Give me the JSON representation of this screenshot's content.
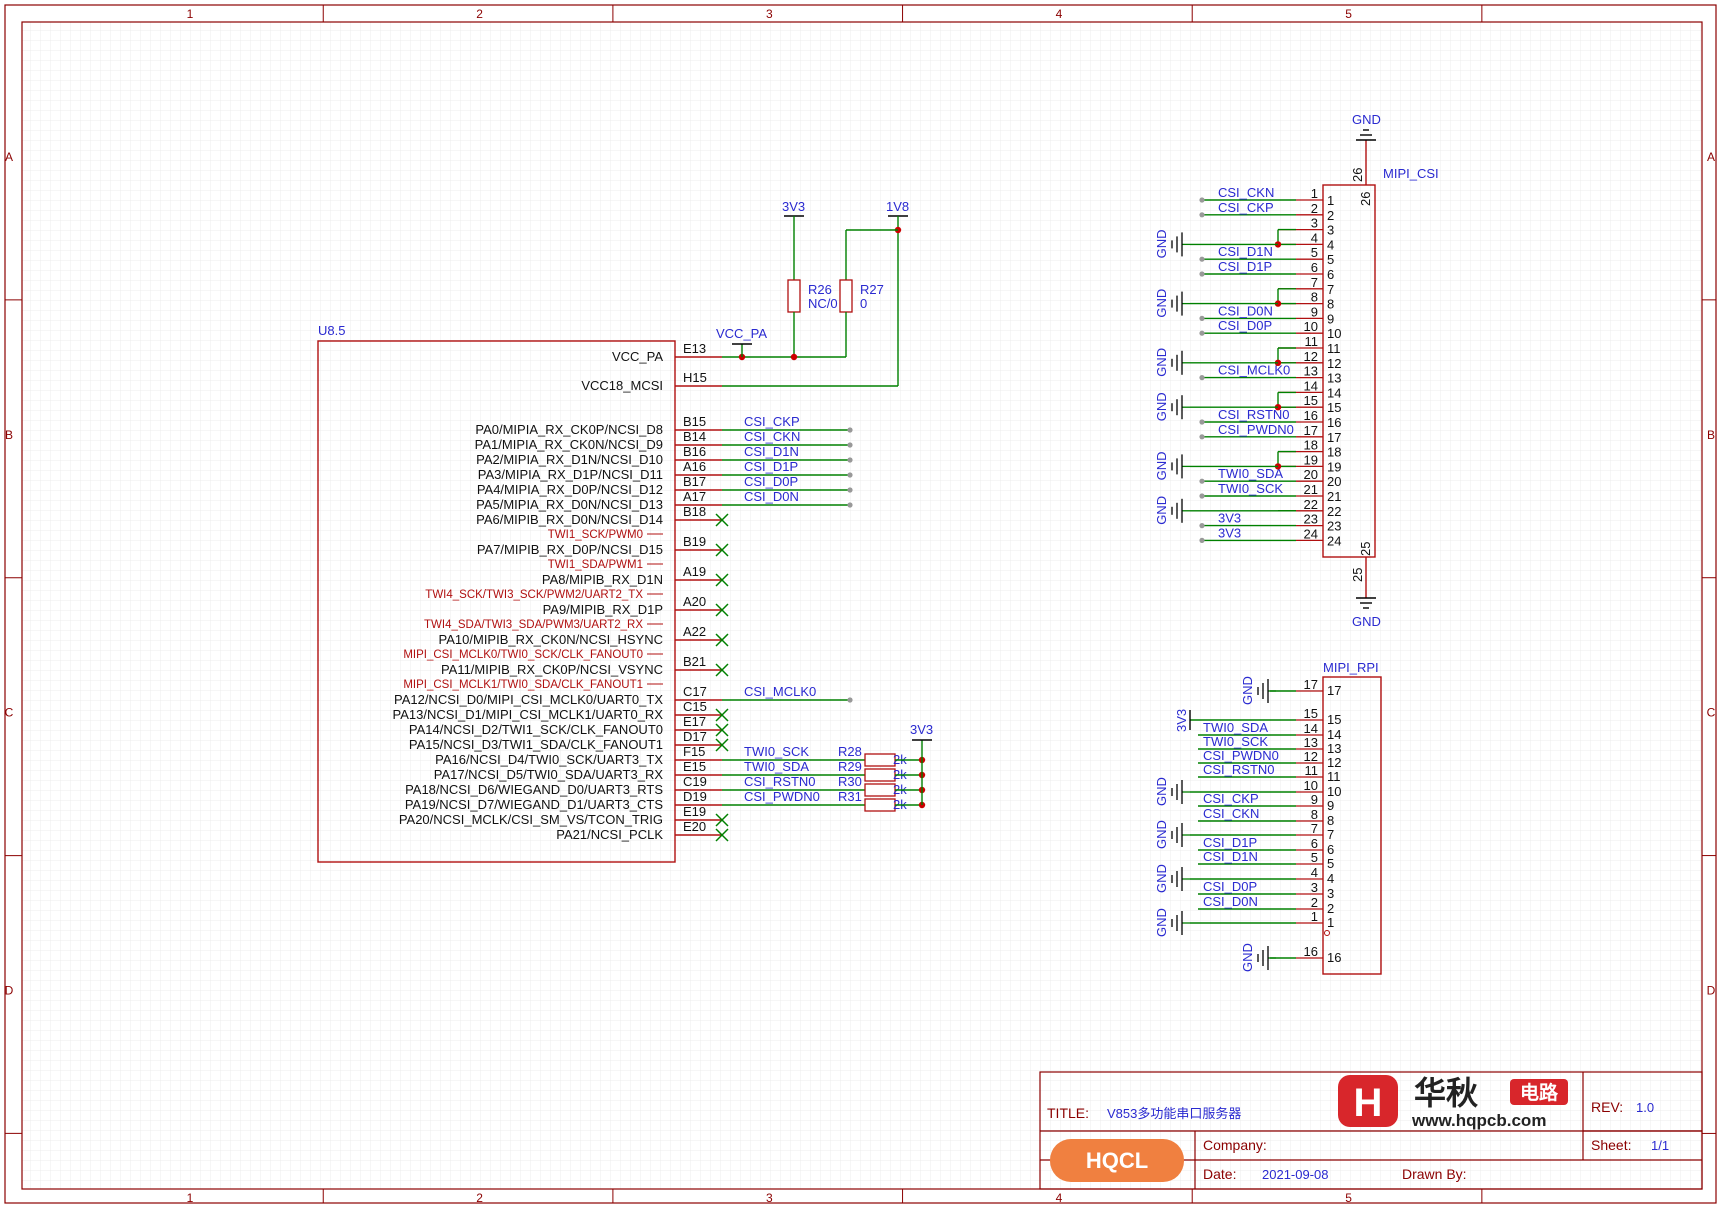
{
  "frame": {
    "columns": [
      "1",
      "2",
      "3",
      "4",
      "5"
    ],
    "rows": [
      "A",
      "B",
      "C",
      "D"
    ]
  },
  "u8": {
    "ref": "U8.5",
    "pins": [
      {
        "name": "VCC_PA",
        "num": "E13"
      },
      {
        "name": "VCC18_MCSI",
        "num": "H15"
      },
      {
        "name": "PA0/MIPIA_RX_CK0P/NCSI_D8",
        "num": "B15",
        "net": "CSI_CKP"
      },
      {
        "name": "PA1/MIPIA_RX_CK0N/NCSI_D9",
        "num": "B14",
        "net": "CSI_CKN"
      },
      {
        "name": "PA2/MIPIA_RX_D1N/NCSI_D10",
        "num": "B16",
        "net": "CSI_D1N"
      },
      {
        "name": "PA3/MIPIA_RX_D1P/NCSI_D11",
        "num": "A16",
        "net": "CSI_D1P"
      },
      {
        "name": "PA4/MIPIA_RX_D0P/NCSI_D12",
        "num": "B17",
        "net": "CSI_D0P"
      },
      {
        "name": "PA5/MIPIA_RX_D0N/NCSI_D13",
        "num": "A17",
        "net": "CSI_D0N"
      },
      {
        "name": "PA6/MIPIB_RX_D0N/NCSI_D14",
        "num": "B18",
        "alt": "TWI1_SCK/PWM0"
      },
      {
        "name": "PA7/MIPIB_RX_D0P/NCSI_D15",
        "num": "B19",
        "alt": "TWI1_SDA/PWM1"
      },
      {
        "name": "PA8/MIPIB_RX_D1N",
        "num": "A19",
        "alt": "TWI4_SCK/TWI3_SCK/PWM2/UART2_TX"
      },
      {
        "name": "PA9/MIPIB_RX_D1P",
        "num": "A20",
        "alt": "TWI4_SDA/TWI3_SDA/PWM3/UART2_RX"
      },
      {
        "name": "PA10/MIPIB_RX_CK0N/NCSI_HSYNC",
        "num": "A22",
        "alt": "MIPI_CSI_MCLK0/TWI0_SCK/CLK_FANOUT0"
      },
      {
        "name": "PA11/MIPIB_RX_CK0P/NCSI_VSYNC",
        "num": "B21",
        "alt": "MIPI_CSI_MCLK1/TWI0_SDA/CLK_FANOUT1"
      },
      {
        "name": "PA12/NCSI_D0/MIPI_CSI_MCLK0/UART0_TX",
        "num": "C17",
        "net": "CSI_MCLK0"
      },
      {
        "name": "PA13/NCSI_D1/MIPI_CSI_MCLK1/UART0_RX",
        "num": "C15"
      },
      {
        "name": "PA14/NCSI_D2/TWI1_SCK/CLK_FANOUT0",
        "num": "E17"
      },
      {
        "name": "PA15/NCSI_D3/TWI1_SDA/CLK_FANOUT1",
        "num": "D17"
      },
      {
        "name": "PA16/NCSI_D4/TWI0_SCK/UART3_TX",
        "num": "F15",
        "net": "TWI0_SCK",
        "res": "R28",
        "val": "2k"
      },
      {
        "name": "PA17/NCSI_D5/TWI0_SDA/UART3_RX",
        "num": "E15",
        "net": "TWI0_SDA",
        "res": "R29",
        "val": "2k"
      },
      {
        "name": "PA18/NCSI_D6/WIEGAND_D0/UART3_RTS",
        "num": "C19",
        "net": "CSI_RSTN0",
        "res": "R30",
        "val": "2k"
      },
      {
        "name": "PA19/NCSI_D7/WIEGAND_D1/UART3_CTS",
        "num": "D19",
        "net": "CSI_PWDN0",
        "res": "R31",
        "val": "2k"
      },
      {
        "name": "PA20/NCSI_MCLK/CSI_SM_VS/TCON_TRIG",
        "num": "E19"
      },
      {
        "name": "PA21/NCSI_PCLK",
        "num": "E20"
      }
    ]
  },
  "power": {
    "v33": "3V3",
    "v18": "1V8",
    "vcc_pa": "VCC_PA",
    "gnd": "GND",
    "r26": {
      "ref": "R26",
      "val": "NC/0"
    },
    "r27": {
      "ref": "R27",
      "val": "0"
    }
  },
  "mipi_csi": {
    "ref": "MIPI_CSI",
    "top_pin": "26",
    "bottom_pin": "25",
    "pins": [
      {
        "n": "1",
        "net": "CSI_CKN",
        "kind": "net"
      },
      {
        "n": "2",
        "net": "CSI_CKP",
        "kind": "net"
      },
      {
        "n": "3",
        "kind": "gnd"
      },
      {
        "n": "4",
        "kind": "gnd"
      },
      {
        "n": "5",
        "net": "CSI_D1N",
        "kind": "net"
      },
      {
        "n": "6",
        "net": "CSI_D1P",
        "kind": "net"
      },
      {
        "n": "7",
        "kind": "gnd"
      },
      {
        "n": "8",
        "kind": "gnd"
      },
      {
        "n": "9",
        "net": "CSI_D0N",
        "kind": "net"
      },
      {
        "n": "10",
        "net": "CSI_D0P",
        "kind": "net"
      },
      {
        "n": "11",
        "kind": "gnd"
      },
      {
        "n": "12",
        "kind": "gnd"
      },
      {
        "n": "13",
        "net": "CSI_MCLK0",
        "kind": "net"
      },
      {
        "n": "14",
        "kind": "gnd"
      },
      {
        "n": "15",
        "kind": "gnd"
      },
      {
        "n": "16",
        "net": "CSI_RSTN0",
        "kind": "net"
      },
      {
        "n": "17",
        "net": "CSI_PWDN0",
        "kind": "net"
      },
      {
        "n": "18",
        "kind": "gnd"
      },
      {
        "n": "19",
        "kind": "gnd"
      },
      {
        "n": "20",
        "net": "TWI0_SDA",
        "kind": "net"
      },
      {
        "n": "21",
        "net": "TWI0_SCK",
        "kind": "net"
      },
      {
        "n": "22",
        "kind": "gnd"
      },
      {
        "n": "23",
        "net": "3V3",
        "kind": "net"
      },
      {
        "n": "24",
        "net": "3V3",
        "kind": "net"
      }
    ]
  },
  "mipi_rpi": {
    "ref": "MIPI_RPI",
    "rows": [
      {
        "left": "17",
        "right": "17",
        "kind": "gnd"
      },
      {
        "left": "15",
        "right": "15",
        "kind": "pwr",
        "label": "3V3"
      },
      {
        "left": "14",
        "right": "14",
        "net": "TWI0_SDA"
      },
      {
        "left": "13",
        "right": "13",
        "net": "TWI0_SCK"
      },
      {
        "left": "12",
        "right": "12",
        "net": "CSI_PWDN0"
      },
      {
        "left": "11",
        "right": "11",
        "net": "CSI_RSTN0"
      },
      {
        "left": "10",
        "right": "10",
        "kind": "gnd"
      },
      {
        "left": "9",
        "right": "9",
        "net": "CSI_CKP"
      },
      {
        "left": "8",
        "right": "8",
        "net": "CSI_CKN"
      },
      {
        "left": "7",
        "right": "7",
        "kind": "gnd"
      },
      {
        "left": "6",
        "right": "6",
        "net": "CSI_D1P"
      },
      {
        "left": "5",
        "right": "5",
        "net": "CSI_D1N"
      },
      {
        "left": "4",
        "right": "4",
        "kind": "gnd"
      },
      {
        "left": "3",
        "right": "3",
        "net": "CSI_D0P"
      },
      {
        "left": "2",
        "right": "2",
        "net": "CSI_D0N"
      },
      {
        "left": "1",
        "right": "1",
        "kind": "gnd"
      },
      {
        "left": "16",
        "right": "16",
        "kind": "gnd"
      }
    ]
  },
  "title_block": {
    "title_label": "TITLE:",
    "title": "V853多功能串口服务器",
    "rev_label": "REV:",
    "rev": "1.0",
    "company_label": "Company:",
    "sheet_label": "Sheet:",
    "sheet": "1/1",
    "date_label": "Date:",
    "date": "2021-09-08",
    "drawn_label": "Drawn By:",
    "logo_text": "华秋",
    "logo_badge": "电路",
    "logo_url": "www.hqpcb.com",
    "logo_left": "HQCL"
  },
  "colors": {
    "frame": "#8b0000",
    "wire": "#008000",
    "net": "#2a2ad0",
    "body": "#b01010",
    "junction": "#cc0000",
    "grid": "#e6e6e6"
  }
}
